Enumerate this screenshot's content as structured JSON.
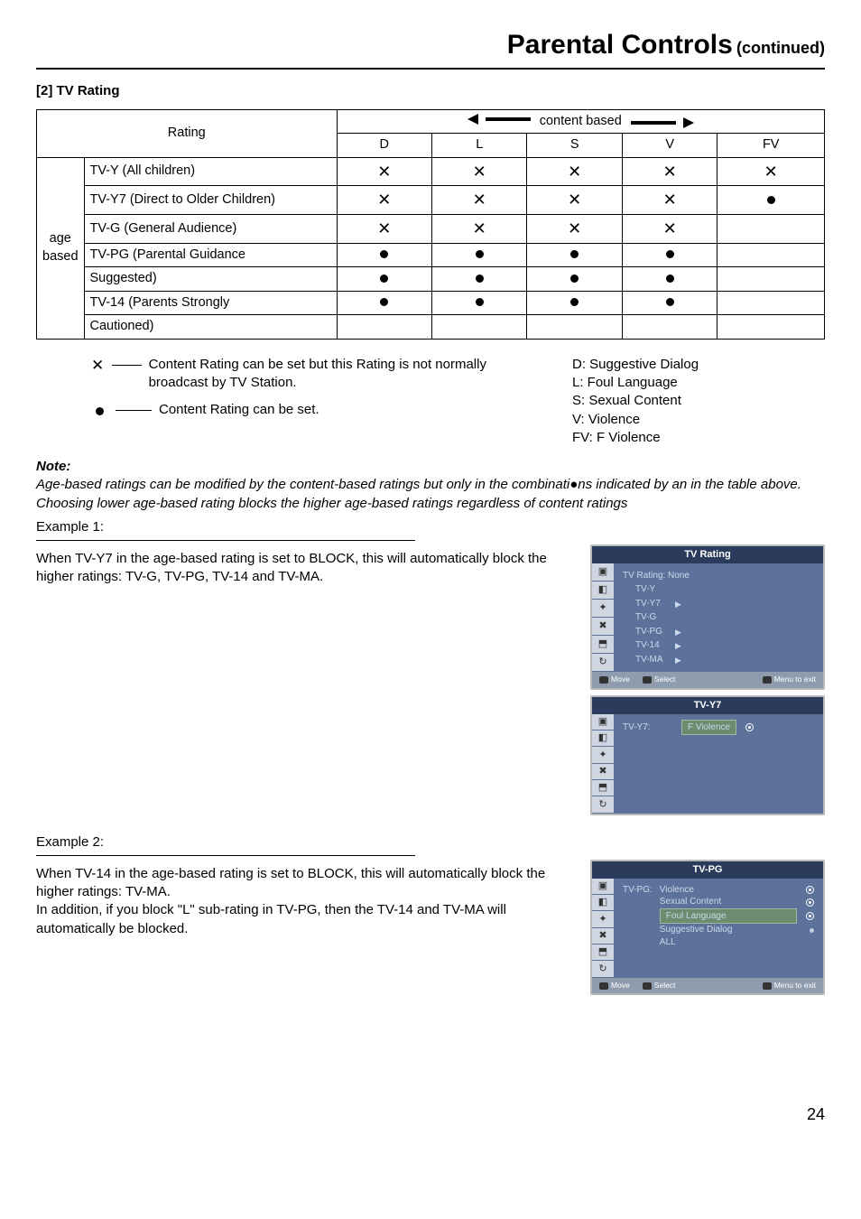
{
  "page_title": {
    "main": "Parental Controls",
    "cont": "(continued)"
  },
  "section_heading": "[2] TV Rating",
  "table": {
    "rating_header": "Rating",
    "content_based_label": "content based",
    "age_based_label": "age based",
    "cols": [
      "D",
      "L",
      "S",
      "V",
      "FV"
    ],
    "rows": [
      {
        "label": "TV-Y (All children)",
        "cells": [
          "x",
          "x",
          "x",
          "x",
          "x"
        ]
      },
      {
        "label": "TV-Y7 (Direct to Older Children)",
        "cells": [
          "x",
          "x",
          "x",
          "x",
          "dot"
        ]
      },
      {
        "label": "TV-G (General Audience)",
        "cells": [
          "x",
          "x",
          "x",
          "x",
          ""
        ]
      },
      {
        "label": "TV-PG (Parental Guidance",
        "cells": [
          "dot",
          "dot",
          "dot",
          "dot",
          ""
        ]
      },
      {
        "label": "Suggested)",
        "cells": [
          "dot",
          "dot",
          "dot",
          "dot",
          ""
        ]
      },
      {
        "label": "TV-14 (Parents Strongly",
        "cells": [
          "dot",
          "dot",
          "dot",
          "dot",
          ""
        ]
      },
      {
        "label": "Cautioned)",
        "cells": [
          "",
          "",
          "",
          "",
          ""
        ]
      }
    ]
  },
  "legend": {
    "x_text": "Content Rating can be set but this Rating is not normally broadcast by TV Station.",
    "dot_text": "Content Rating can be set.",
    "defs": [
      "D: Suggestive Dialog",
      "L: Foul  Language",
      "S: Sexual Content",
      "V: Violence",
      "FV: F Violence"
    ]
  },
  "note": {
    "heading": "Note:",
    "line1": "Age-based ratings can be modified by the content-based ratings but only in the combinati●ns indicated by an    in the table above.",
    "line2": "Choosing lower age-based rating blocks the higher age-based ratings regardless of content ratings"
  },
  "example1": {
    "label": "Example 1:",
    "text": "When TV-Y7 in the age-based rating is set to BLOCK, this will automatically block the higher ratings: TV-G, TV-PG, TV-14 and TV-MA."
  },
  "example2": {
    "label": "Example 2:",
    "text1": "When TV-14 in the age-based rating is set to BLOCK, this will automatically block the higher ratings: TV-MA.",
    "text2": "In addition, if you block \"L\" sub-rating in TV-PG, then the TV-14 and TV-MA will automatically be blocked."
  },
  "osd1": {
    "title": "TV Rating",
    "header_row": "TV Rating: None",
    "items": [
      "TV-Y",
      "TV-Y7",
      "TV-G",
      "TV-PG",
      "TV-14",
      "TV-MA"
    ],
    "footer": {
      "move": "Move",
      "select": "Select",
      "menu": "Menu to exit"
    }
  },
  "osd2": {
    "title": "TV-Y7",
    "row_label": "TV-Y7:",
    "row_value": "F Violence"
  },
  "osd3": {
    "title": "TV-PG",
    "row_label": "TV-PG:",
    "items": [
      {
        "label": "Violence",
        "state": "circ"
      },
      {
        "label": "Sexual Content",
        "state": "circ"
      },
      {
        "label": "Foul Language",
        "state": "circ-sel"
      },
      {
        "label": "Suggestive Dialog",
        "state": "bullet"
      },
      {
        "label": "ALL",
        "state": ""
      }
    ],
    "footer": {
      "move": "Move",
      "select": "Select",
      "menu": "Menu to exit"
    }
  },
  "page_number": "24",
  "chart_data": {
    "type": "table",
    "description": "TV Rating matrix: rows are age-based ratings, columns are content-based sub-ratings. 'x' = settable but not normally broadcast, 'dot' = settable, '' = not applicable.",
    "columns": [
      "D",
      "L",
      "S",
      "V",
      "FV"
    ],
    "rows": {
      "TV-Y (All children)": [
        "x",
        "x",
        "x",
        "x",
        "x"
      ],
      "TV-Y7 (Direct to Older Children)": [
        "x",
        "x",
        "x",
        "x",
        "dot"
      ],
      "TV-G (General Audience)": [
        "x",
        "x",
        "x",
        "x",
        ""
      ],
      "TV-PG (Parental Guidance Suggested)": [
        "dot",
        "dot",
        "dot",
        "dot",
        ""
      ],
      "TV-14 (Parents Strongly Cautioned)": [
        "dot",
        "dot",
        "dot",
        "dot",
        ""
      ]
    }
  }
}
